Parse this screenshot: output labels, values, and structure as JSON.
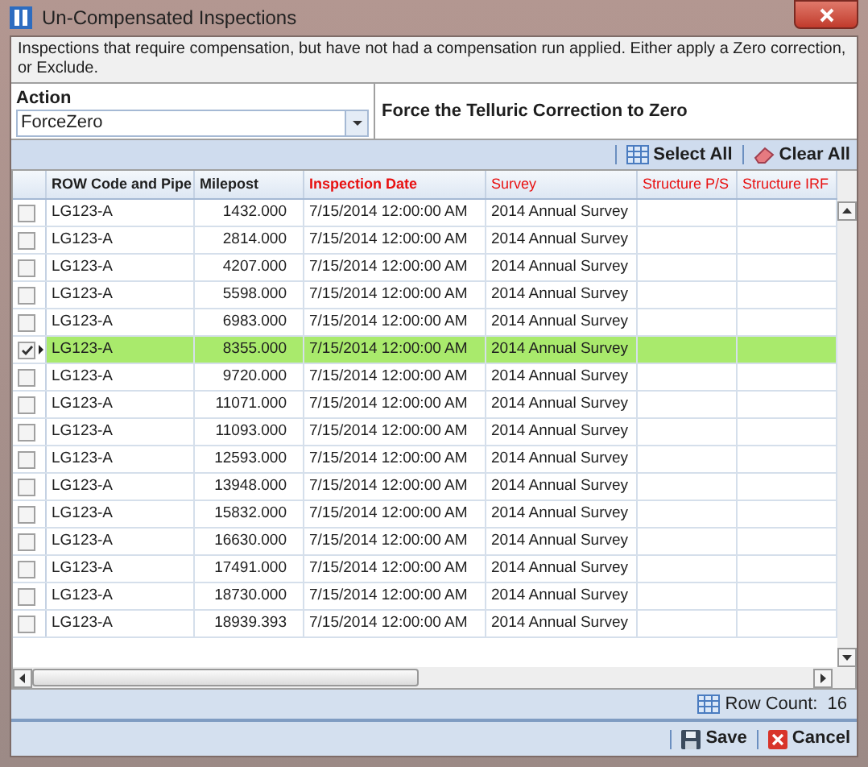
{
  "window": {
    "title": "Un-Compensated Inspections"
  },
  "message": "Inspections that require compensation, but have not had a compensation run applied.  Either apply a Zero correction, or Exclude.",
  "action": {
    "label": "Action",
    "value": "ForceZero",
    "description": "Force the Telluric Correction to Zero"
  },
  "toolbar": [
    "Select All",
    "Clear All"
  ],
  "table": {
    "columns": [
      {
        "label": "ROW Code and Pipe",
        "required": false
      },
      {
        "label": "Milepost",
        "required": false
      },
      {
        "label": "Inspection Date",
        "required": true
      },
      {
        "label": "Survey",
        "required": true
      },
      {
        "label": "Structure P/S",
        "required": true
      },
      {
        "label": "Structure IRF",
        "required": true
      }
    ],
    "rows": [
      {
        "checked": false,
        "selected": false,
        "cells": [
          "LG123-A",
          "1432.000",
          "7/15/2014 12:00:00 AM",
          "2014 Annual Survey"
        ]
      },
      {
        "checked": false,
        "selected": false,
        "cells": [
          "LG123-A",
          "2814.000",
          "7/15/2014 12:00:00 AM",
          "2014 Annual Survey"
        ]
      },
      {
        "checked": false,
        "selected": false,
        "cells": [
          "LG123-A",
          "4207.000",
          "7/15/2014 12:00:00 AM",
          "2014 Annual Survey"
        ]
      },
      {
        "checked": false,
        "selected": false,
        "cells": [
          "LG123-A",
          "5598.000",
          "7/15/2014 12:00:00 AM",
          "2014 Annual Survey"
        ]
      },
      {
        "checked": false,
        "selected": false,
        "cells": [
          "LG123-A",
          "6983.000",
          "7/15/2014 12:00:00 AM",
          "2014 Annual Survey"
        ]
      },
      {
        "checked": true,
        "selected": true,
        "cells": [
          "LG123-A",
          "8355.000",
          "7/15/2014 12:00:00 AM",
          "2014 Annual Survey"
        ]
      },
      {
        "checked": false,
        "selected": false,
        "cells": [
          "LG123-A",
          "9720.000",
          "7/15/2014 12:00:00 AM",
          "2014 Annual Survey"
        ]
      },
      {
        "checked": false,
        "selected": false,
        "cells": [
          "LG123-A",
          "11071.000",
          "7/15/2014 12:00:00 AM",
          "2014 Annual Survey"
        ]
      },
      {
        "checked": false,
        "selected": false,
        "cells": [
          "LG123-A",
          "11093.000",
          "7/15/2014 12:00:00 AM",
          "2014 Annual Survey"
        ]
      },
      {
        "checked": false,
        "selected": false,
        "cells": [
          "LG123-A",
          "12593.000",
          "7/15/2014 12:00:00 AM",
          "2014 Annual Survey"
        ]
      },
      {
        "checked": false,
        "selected": false,
        "cells": [
          "LG123-A",
          "13948.000",
          "7/15/2014 12:00:00 AM",
          "2014 Annual Survey"
        ]
      },
      {
        "checked": false,
        "selected": false,
        "cells": [
          "LG123-A",
          "15832.000",
          "7/15/2014 12:00:00 AM",
          "2014 Annual Survey"
        ]
      },
      {
        "checked": false,
        "selected": false,
        "cells": [
          "LG123-A",
          "16630.000",
          "7/15/2014 12:00:00 AM",
          "2014 Annual Survey"
        ]
      },
      {
        "checked": false,
        "selected": false,
        "cells": [
          "LG123-A",
          "17491.000",
          "7/15/2014 12:00:00 AM",
          "2014 Annual Survey"
        ]
      },
      {
        "checked": false,
        "selected": false,
        "cells": [
          "LG123-A",
          "18730.000",
          "7/15/2014 12:00:00 AM",
          "2014 Annual Survey"
        ]
      },
      {
        "checked": false,
        "selected": false,
        "cells": [
          "LG123-A",
          "18939.393",
          "7/15/2014 12:00:00 AM",
          "2014 Annual Survey"
        ]
      }
    ]
  },
  "row_count": {
    "label": "Row Count:",
    "value": "16"
  },
  "buttons": [
    "Save",
    "Cancel"
  ]
}
